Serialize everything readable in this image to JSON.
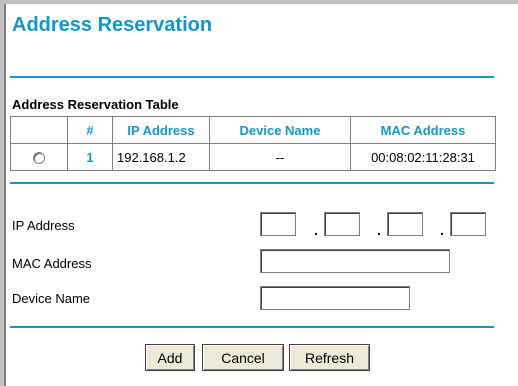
{
  "page": {
    "title": "Address Reservation"
  },
  "table": {
    "title": "Address Reservation Table",
    "headers": {
      "select": "",
      "number": "#",
      "ip": "IP Address",
      "device": "Device Name",
      "mac": "MAC Address"
    },
    "rows": [
      {
        "number": "1",
        "ip": "192.168.1.2",
        "device": "--",
        "mac": "00:08:02:11:28:31"
      }
    ]
  },
  "form": {
    "ip_label": "IP Address",
    "mac_label": "MAC Address",
    "device_label": "Device Name",
    "ip_octets": [
      "",
      "",
      "",
      ""
    ],
    "ip_separator": ".",
    "mac_value": "",
    "device_value": ""
  },
  "buttons": {
    "add": "Add",
    "cancel": "Cancel",
    "refresh": "Refresh"
  },
  "colors": {
    "accent": "#1596c5"
  }
}
